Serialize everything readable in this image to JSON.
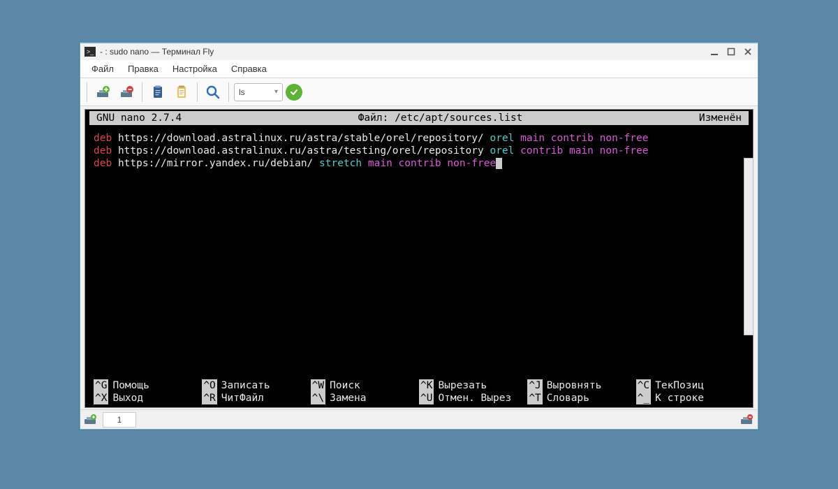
{
  "titlebar": {
    "icon_glyph": ">_",
    "title": "- : sudo nano — Терминал Fly"
  },
  "menubar": {
    "items": [
      {
        "label": "Файл"
      },
      {
        "label": "Правка"
      },
      {
        "label": "Настройка"
      },
      {
        "label": "Справка"
      }
    ]
  },
  "toolbar": {
    "combo_value": "ls"
  },
  "terminal": {
    "header": {
      "left": "GNU nano 2.7.4",
      "center": "Файл: /etc/apt/sources.list",
      "right": "Изменён"
    },
    "lines": [
      {
        "deb": "deb",
        "url": "https://download.astralinux.ru/astra/stable/orel/repository/",
        "dist": "orel",
        "comps": "main contrib non-free"
      },
      {
        "deb": "deb",
        "url": "https://download.astralinux.ru/astra/testing/orel/repository",
        "dist": "orel",
        "comps": "contrib main non-free"
      },
      {
        "deb": "deb",
        "url": "https://mirror.yandex.ru/debian/",
        "dist": "stretch",
        "comps": "main contrib non-free"
      }
    ],
    "shortcuts": {
      "row1": [
        {
          "key": "^G",
          "label": "Помощь"
        },
        {
          "key": "^O",
          "label": "Записать"
        },
        {
          "key": "^W",
          "label": "Поиск"
        },
        {
          "key": "^K",
          "label": "Вырезать"
        },
        {
          "key": "^J",
          "label": "Выровнять"
        },
        {
          "key": "^C",
          "label": "ТекПозиц"
        }
      ],
      "row2": [
        {
          "key": "^X",
          "label": "Выход"
        },
        {
          "key": "^R",
          "label": "ЧитФайл"
        },
        {
          "key": "^\\",
          "label": "Замена"
        },
        {
          "key": "^U",
          "label": "Отмен. Вырез"
        },
        {
          "key": "^T",
          "label": "Словарь"
        },
        {
          "key": "^_",
          "label": "К строке"
        }
      ]
    }
  },
  "statusbar": {
    "tab_number": "1"
  }
}
